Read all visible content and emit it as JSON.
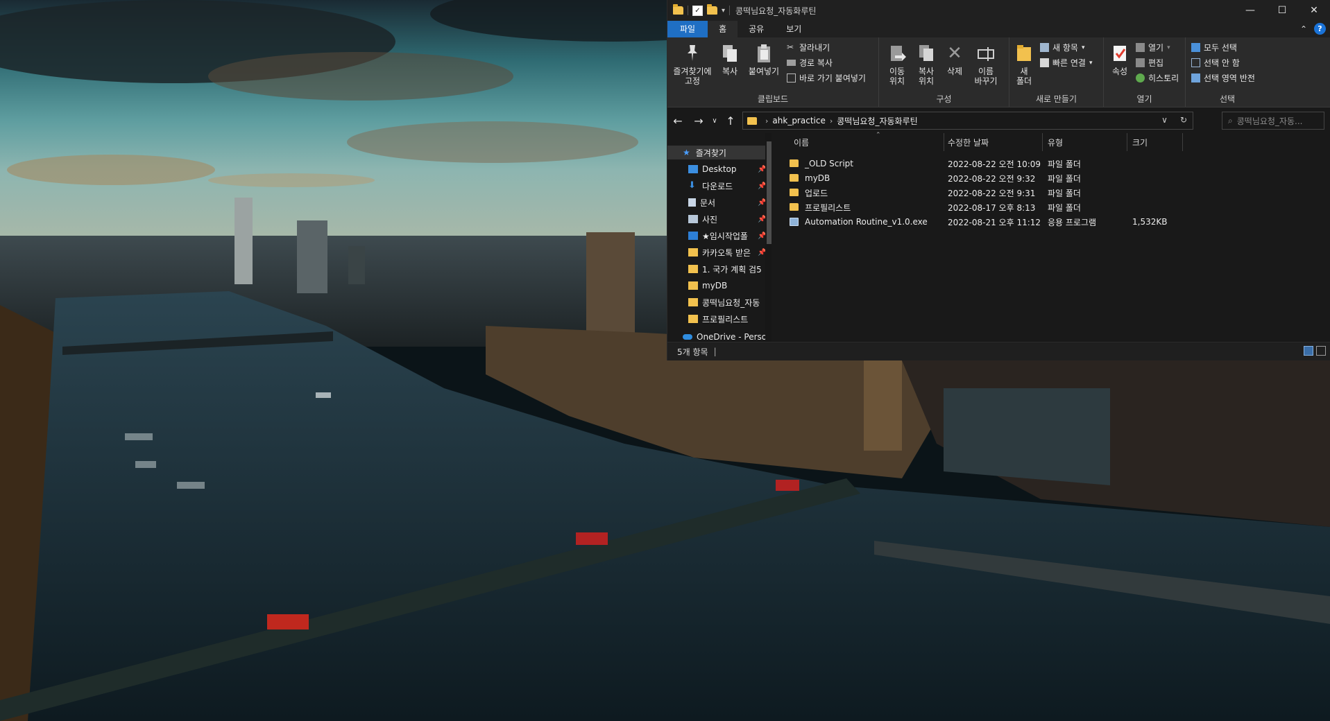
{
  "window": {
    "title": "콩떡님요청_자동화루틴",
    "controls": {
      "minimize": "—",
      "maximize": "☐",
      "close": "✕"
    }
  },
  "ribbon": {
    "tabs": [
      {
        "label": "파일",
        "type": "file"
      },
      {
        "label": "홈",
        "active": true
      },
      {
        "label": "공유"
      },
      {
        "label": "보기"
      }
    ],
    "collapse": "⌃",
    "help": "?",
    "clipboard": {
      "pin": "즐겨찾기에\n고정",
      "copy": "복사",
      "paste": "붙여넣기",
      "cut": "잘라내기",
      "copy_path": "경로 복사",
      "paste_shortcut": "바로 가기 붙여넣기",
      "label": "클립보드"
    },
    "organize": {
      "move_to": "이동\n위치",
      "copy_to": "복사\n위치",
      "delete": "삭제",
      "rename": "이름\n바꾸기",
      "label": "구성"
    },
    "new": {
      "new_folder": "새\n폴더",
      "new_item": "새 항목",
      "easy_access": "빠른 연결",
      "label": "새로 만들기"
    },
    "open": {
      "properties": "속성",
      "open": "열기",
      "edit": "편집",
      "history": "히스토리",
      "label": "열기"
    },
    "select": {
      "select_all": "모두 선택",
      "select_none": "선택 안 함",
      "invert": "선택 영역 반전",
      "label": "선택"
    }
  },
  "address": {
    "crumbs": [
      "ahk_practice",
      "콩떡님요청_자동화루틴"
    ],
    "search_placeholder": "콩떡님요청_자동..."
  },
  "navpane": {
    "items": [
      {
        "label": "즐겨찾기",
        "icon": "star-icon",
        "color": "#4a9eff",
        "pinned": false,
        "selected": true
      },
      {
        "label": "Desktop",
        "icon": "desktop-icon",
        "color": "#3b8ee0",
        "pinned": true
      },
      {
        "label": "다운로드",
        "icon": "download-icon",
        "color": "#3b8ee0",
        "pinned": true
      },
      {
        "label": "문서",
        "icon": "document-icon",
        "color": "#c9d6e6",
        "pinned": true
      },
      {
        "label": "사진",
        "icon": "picture-icon",
        "color": "#c9d6e6",
        "pinned": true
      },
      {
        "label": "★임시작업폴",
        "icon": "folder-icon",
        "color": "#2d7fd6",
        "pinned": true
      },
      {
        "label": "카카오톡 받은",
        "icon": "folder-icon",
        "color": "#f2c14e",
        "pinned": true
      },
      {
        "label": "1. 국가 계획 검5",
        "icon": "folder-icon",
        "color": "#f2c14e",
        "pinned": false
      },
      {
        "label": "myDB",
        "icon": "folder-icon",
        "color": "#f2c14e",
        "pinned": false
      },
      {
        "label": "콩떡님요청_자동",
        "icon": "folder-icon",
        "color": "#f2c14e",
        "pinned": false
      },
      {
        "label": "프로필리스트",
        "icon": "folder-icon",
        "color": "#f2c14e",
        "pinned": false
      },
      {
        "label": "OneDrive - Persor",
        "icon": "cloud-icon",
        "color": "#2f8de0",
        "pinned": false
      }
    ]
  },
  "filelist": {
    "columns": {
      "name": "이름",
      "date": "수정한 날짜",
      "type": "유형",
      "size": "크기"
    },
    "rows": [
      {
        "name": "_OLD Script",
        "date": "2022-08-22 오전 10:09",
        "type": "파일 폴더",
        "size": "",
        "icon": "folder-icon"
      },
      {
        "name": "myDB",
        "date": "2022-08-22 오전 9:32",
        "type": "파일 폴더",
        "size": "",
        "icon": "folder-icon"
      },
      {
        "name": "업로드",
        "date": "2022-08-22 오전 9:31",
        "type": "파일 폴더",
        "size": "",
        "icon": "folder-icon"
      },
      {
        "name": "프로필리스트",
        "date": "2022-08-17 오후 8:13",
        "type": "파일 폴더",
        "size": "",
        "icon": "folder-icon"
      },
      {
        "name": "Automation Routine_v1.0.exe",
        "date": "2022-08-21 오후 11:12",
        "type": "응용 프로그램",
        "size": "1,532KB",
        "icon": "exe-icon"
      }
    ]
  },
  "status": {
    "count": "5개 항목"
  },
  "colors": {
    "accent": "#1f6fc4",
    "folder": "#f2c14e",
    "bg": "#191919",
    "ribbon": "#2b2b2b"
  }
}
